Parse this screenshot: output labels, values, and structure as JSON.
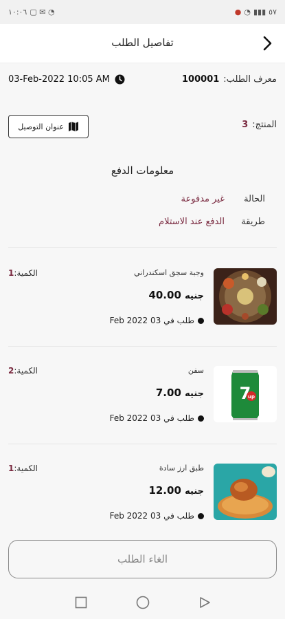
{
  "status_bar": {
    "time": "١٠:٠٦",
    "left_icons": "▢ ✉ ◔",
    "battery_text": "٥٧"
  },
  "header": {
    "title": "تفاصيل الطلب"
  },
  "order": {
    "id_label": "معرف الطلب:",
    "id_value": "100001",
    "datetime": "03-Feb-2022 10:05 AM",
    "products_label": "المنتج:",
    "products_count": "3",
    "address_button": "عنوان التوصيل"
  },
  "payment": {
    "title": "معلومات الدفع",
    "status_label": "الحالة",
    "status_value": "غير مدفوعة",
    "method_label": "طريقة",
    "method_value": "الدفع عند الاستلام"
  },
  "items": [
    {
      "name": "وجبة سجق اسكندراني",
      "price": "40.00",
      "currency": "جنيه",
      "qty_label": "الكمية:",
      "qty": "1",
      "date": "طلب في 03 Feb 2022"
    },
    {
      "name": "سفن",
      "price": "7.00",
      "currency": "جنيه",
      "qty_label": "الكمية:",
      "qty": "2",
      "date": "طلب في 03 Feb 2022"
    },
    {
      "name": "طبق ارز سادة",
      "price": "12.00",
      "currency": "جنيه",
      "qty_label": "الكمية:",
      "qty": "1",
      "date": "طلب في 03 Feb 2022"
    }
  ],
  "cancel_button": "الغاء الطلب",
  "colors": {
    "accent": "#7a2a40",
    "background": "#f7f7f7"
  }
}
